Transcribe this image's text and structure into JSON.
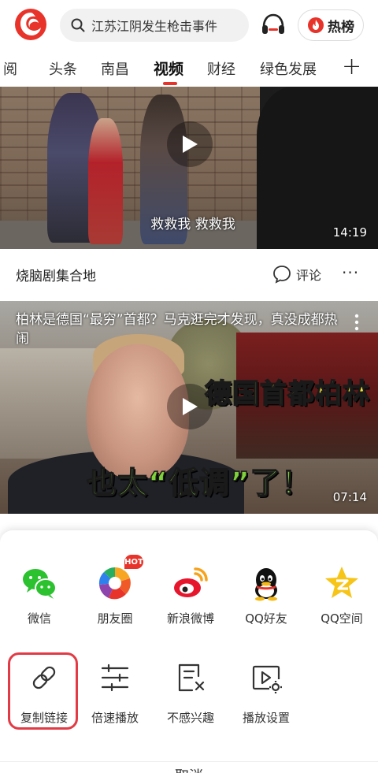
{
  "header": {
    "search_text": "江苏江阴发生枪击事件",
    "hot_label": "热榜"
  },
  "tabs": [
    {
      "label": "订阅",
      "display": "阅"
    },
    {
      "label": "头条"
    },
    {
      "label": "南昌"
    },
    {
      "label": "视频",
      "active": true
    },
    {
      "label": "财经"
    },
    {
      "label": "绿色发展"
    }
  ],
  "tab_add": "+",
  "feed": [
    {
      "caption": "救救我 救救我",
      "duration": "14:19",
      "source": "烧脑剧集合地",
      "comment_label": "评论",
      "more": "···"
    },
    {
      "title": "柏林是德国“最穷”首都？马克逛完才发现，真没成都热闹",
      "overlay_line1": "德国首都柏林",
      "overlay_line2": "也太“低调”了！",
      "duration": "07:14"
    }
  ],
  "share_sheet": {
    "targets": [
      {
        "label": "微信",
        "icon": "wechat-icon"
      },
      {
        "label": "朋友圈",
        "icon": "moments-icon",
        "badge": "HOT"
      },
      {
        "label": "新浪微博",
        "icon": "weibo-icon"
      },
      {
        "label": "QQ好友",
        "icon": "qq-icon"
      },
      {
        "label": "QQ空间",
        "icon": "qzone-icon"
      }
    ],
    "actions": [
      {
        "label": "复制链接",
        "icon": "link-icon",
        "highlighted": true
      },
      {
        "label": "倍速播放",
        "icon": "speed-icon"
      },
      {
        "label": "不感兴趣",
        "icon": "not-interested-icon"
      },
      {
        "label": "播放设置",
        "icon": "play-settings-icon"
      }
    ],
    "cancel_label": "取消"
  },
  "colors": {
    "accent": "#e8332a",
    "highlight_border": "#e23b45",
    "wechat": "#2bc12f",
    "weibo": "#e6162d",
    "qzone": "#f7c518"
  }
}
